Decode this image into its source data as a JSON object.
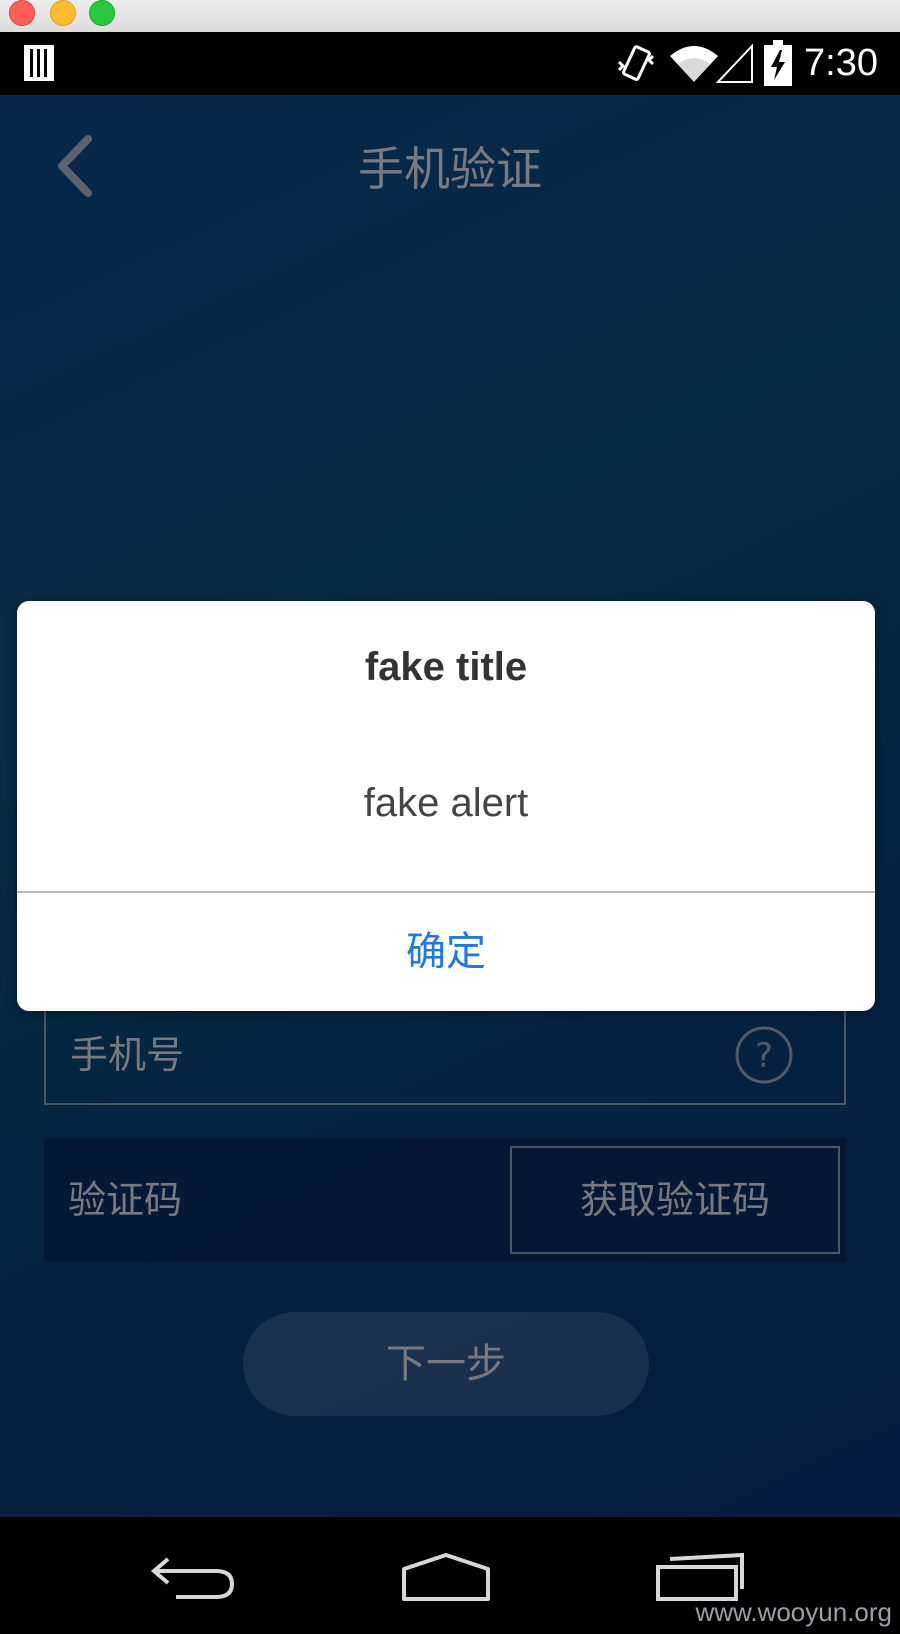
{
  "status_bar": {
    "time": "7:30"
  },
  "header": {
    "title": "手机验证"
  },
  "form": {
    "phone_label": "手机号",
    "code_label": "验证码",
    "get_code_label": "获取验证码",
    "next_label": "下一步"
  },
  "dialog": {
    "title": "fake title",
    "message": "fake alert",
    "confirm_label": "确定"
  },
  "watermark": "www.wooyun.org",
  "colors": {
    "accent": "#1f78e4",
    "screen_bg": "#0b4a6e"
  },
  "icons": [
    "back-icon",
    "help-icon",
    "sim-icon",
    "vibrate-icon",
    "wifi-icon",
    "signal-icon",
    "battery-icon",
    "nav-back-icon",
    "nav-home-icon",
    "nav-recents-icon"
  ]
}
